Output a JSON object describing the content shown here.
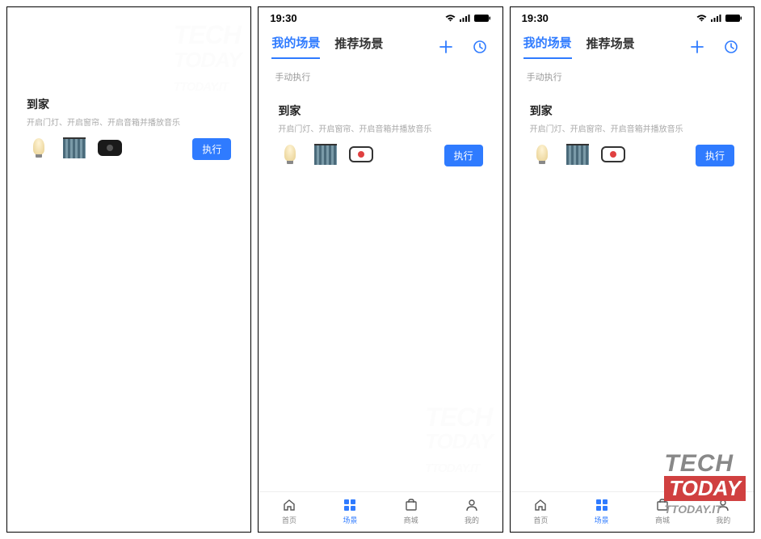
{
  "status": {
    "time": "19:30"
  },
  "tabs": {
    "my_scenes": "我的场景",
    "recommended": "推荐场景"
  },
  "section": {
    "manual": "手动执行"
  },
  "scene": {
    "title": "到家",
    "desc1": "开启门灯、开启窗帘、开启音箱并播放音乐",
    "desc2": "开启门灯、开启窗帘、开启音箱并播放音乐",
    "desc3": "开启门灯、开启窗帘、开启音箱并播放音乐",
    "execute": "执行"
  },
  "nav": {
    "home": "首页",
    "scenes": "场景",
    "store": "商城",
    "mine": "我的"
  },
  "watermark": {
    "tech": "TECH",
    "today": "TODAY",
    "url": "TTODAY.IT"
  }
}
